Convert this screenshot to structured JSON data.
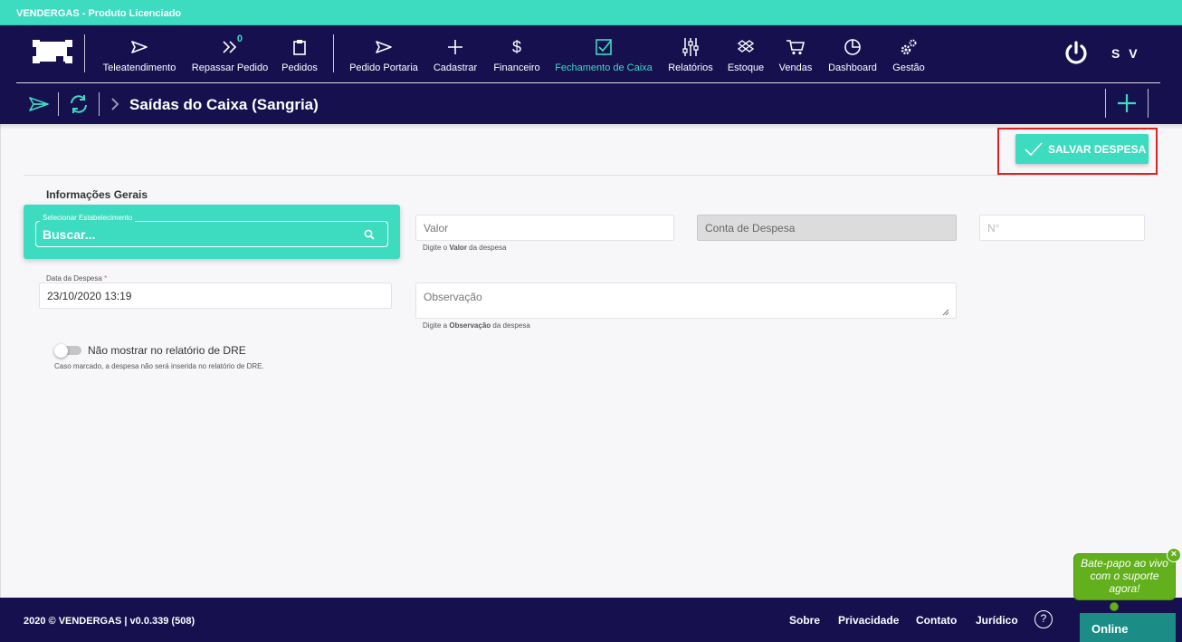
{
  "app": {
    "title": "VENDERGAS - Produto Licenciado"
  },
  "nav": {
    "items": [
      {
        "label": "Teleatendimento",
        "icon": "send-icon"
      },
      {
        "label": "Repassar Pedido",
        "icon": "double-chevron-icon",
        "badge": "0"
      },
      {
        "label": "Pedidos",
        "icon": "clipboard-icon"
      },
      {
        "label": "Pedido Portaria",
        "icon": "send-icon"
      },
      {
        "label": "Cadastrar",
        "icon": "plus-icon"
      },
      {
        "label": "Financeiro",
        "icon": "dollar-icon"
      },
      {
        "label": "Fechamento de Caixa",
        "icon": "checkbox-icon",
        "active": true
      },
      {
        "label": "Relatórios",
        "icon": "sliders-icon"
      },
      {
        "label": "Estoque",
        "icon": "dropbox-icon"
      },
      {
        "label": "Vendas",
        "icon": "cart-icon"
      },
      {
        "label": "Dashboard",
        "icon": "pie-chart-icon"
      },
      {
        "label": "Gestão",
        "icon": "gears-icon"
      }
    ],
    "user_initials": "S V"
  },
  "breadcrumb": {
    "title": "Saídas do Caixa (Sangria)"
  },
  "actions": {
    "save_label": "SALVAR DESPESA"
  },
  "form": {
    "section_title": "Informações Gerais",
    "establishment": {
      "legend": "Selecionar Estabelecimento",
      "placeholder": "Buscar..."
    },
    "valor": {
      "placeholder": "Valor",
      "hint_prefix": "Digite o ",
      "hint_bold": "Valor",
      "hint_suffix": " da despesa"
    },
    "conta": {
      "placeholder": "Conta de Despesa"
    },
    "numero": {
      "placeholder": "N°"
    },
    "data": {
      "label": "Data da Despesa",
      "required_mark": "*",
      "value": "23/10/2020 13:19"
    },
    "observacao": {
      "placeholder": "Observação",
      "hint_prefix": "Digite a ",
      "hint_bold": "Observação",
      "hint_suffix": " da despesa"
    },
    "dre_toggle": {
      "label": "Não mostrar no relatório de DRE",
      "hint": "Caso marcado, a despesa não será inserida no relatório de DRE.",
      "checked": false
    }
  },
  "footer": {
    "copyright": "2020 © VENDERGAS | v0.0.339 (508)",
    "links": [
      "Sobre",
      "Privacidade",
      "Contato",
      "Jurídico"
    ],
    "help": "?"
  },
  "chat": {
    "bubble": "Bate-papo ao vivo com o suporte agora!",
    "close": "×",
    "status": "Online"
  },
  "colors": {
    "accent": "#3ddbc0",
    "navy": "#16104f",
    "highlight": "#e0201f",
    "chat_green": "#62b01c",
    "online_teal": "#1b8d86"
  }
}
